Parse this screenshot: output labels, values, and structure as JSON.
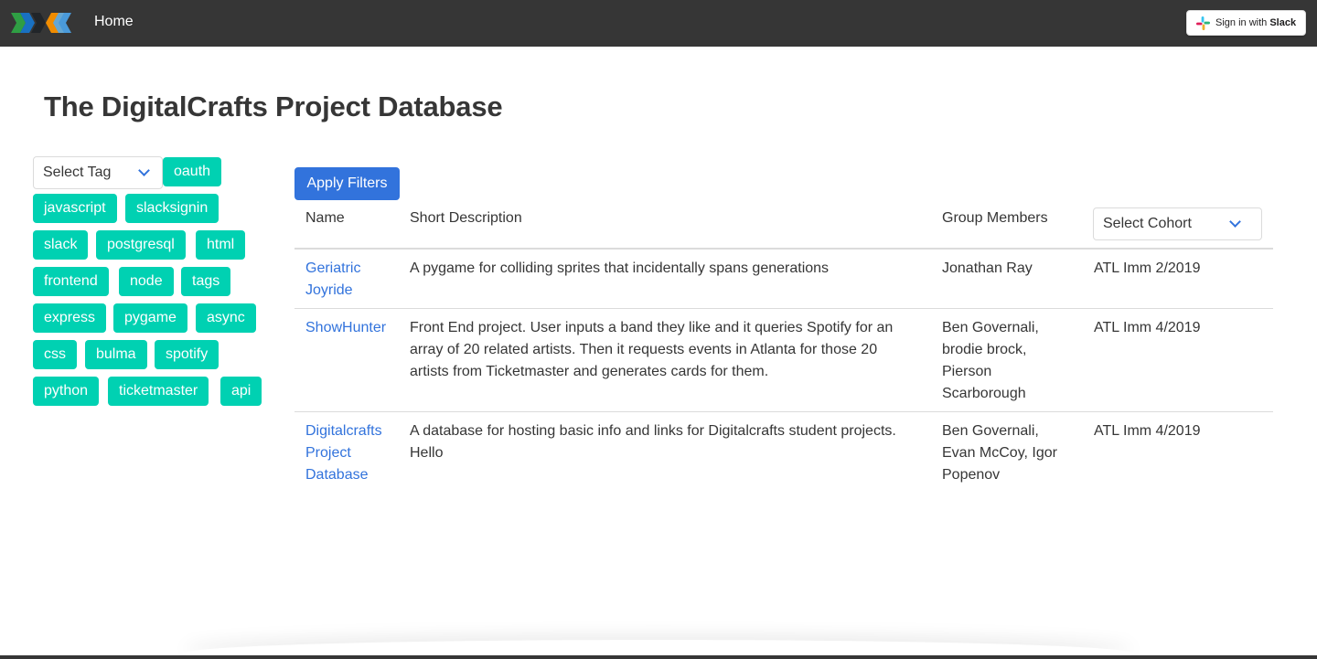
{
  "navbar": {
    "home_label": "Home",
    "slack_signin_prefix": "Sign in with ",
    "slack_signin_brand": "Slack",
    "logo_icon": "digitalcrafts-logo",
    "colors": {
      "background": "#363636"
    }
  },
  "page": {
    "title": "The DigitalCrafts Project Database"
  },
  "filters": {
    "tag_select_placeholder": "Select Tag",
    "tags": [
      "oauth",
      "javascript",
      "slacksignin",
      "slack",
      "postgresql",
      "html",
      "frontend",
      "node",
      "tags",
      "express",
      "pygame",
      "async",
      "css",
      "bulma",
      "spotify",
      "python",
      "ticketmaster",
      "api"
    ],
    "apply_label": "Apply Filters",
    "cohort_select_placeholder": "Select Cohort",
    "colors": {
      "tag": "#00d1b2",
      "primary": "#3273dc"
    }
  },
  "table": {
    "headers": {
      "name": "Name",
      "description": "Short Description",
      "members": "Group Members"
    },
    "rows": [
      {
        "name": [
          "Geriatric",
          "Joyride"
        ],
        "description": [
          "A pygame for colliding sprites that incidentally spans generations"
        ],
        "members": [
          "Jonathan Ray"
        ],
        "cohort": "ATL Imm 2/2019"
      },
      {
        "name": [
          "ShowHunter"
        ],
        "description": [
          "Front End project. User inputs a band they like and it queries Spotify for an",
          "array of 20 related artists. Then it requests events in Atlanta for those 20",
          "artists from Ticketmaster and generates cards for them."
        ],
        "members": [
          "Ben Governali,",
          "brodie brock,",
          "Pierson",
          "Scarborough"
        ],
        "cohort": "ATL Imm 4/2019"
      },
      {
        "name": [
          "Digitalcrafts",
          "Project",
          "Database"
        ],
        "description": [
          "A database for hosting basic info and links for Digitalcrafts student projects.",
          "Hello"
        ],
        "members": [
          "Ben Governali,",
          "Evan McCoy, Igor",
          "Popenov"
        ],
        "cohort": "ATL Imm 4/2019"
      }
    ]
  }
}
